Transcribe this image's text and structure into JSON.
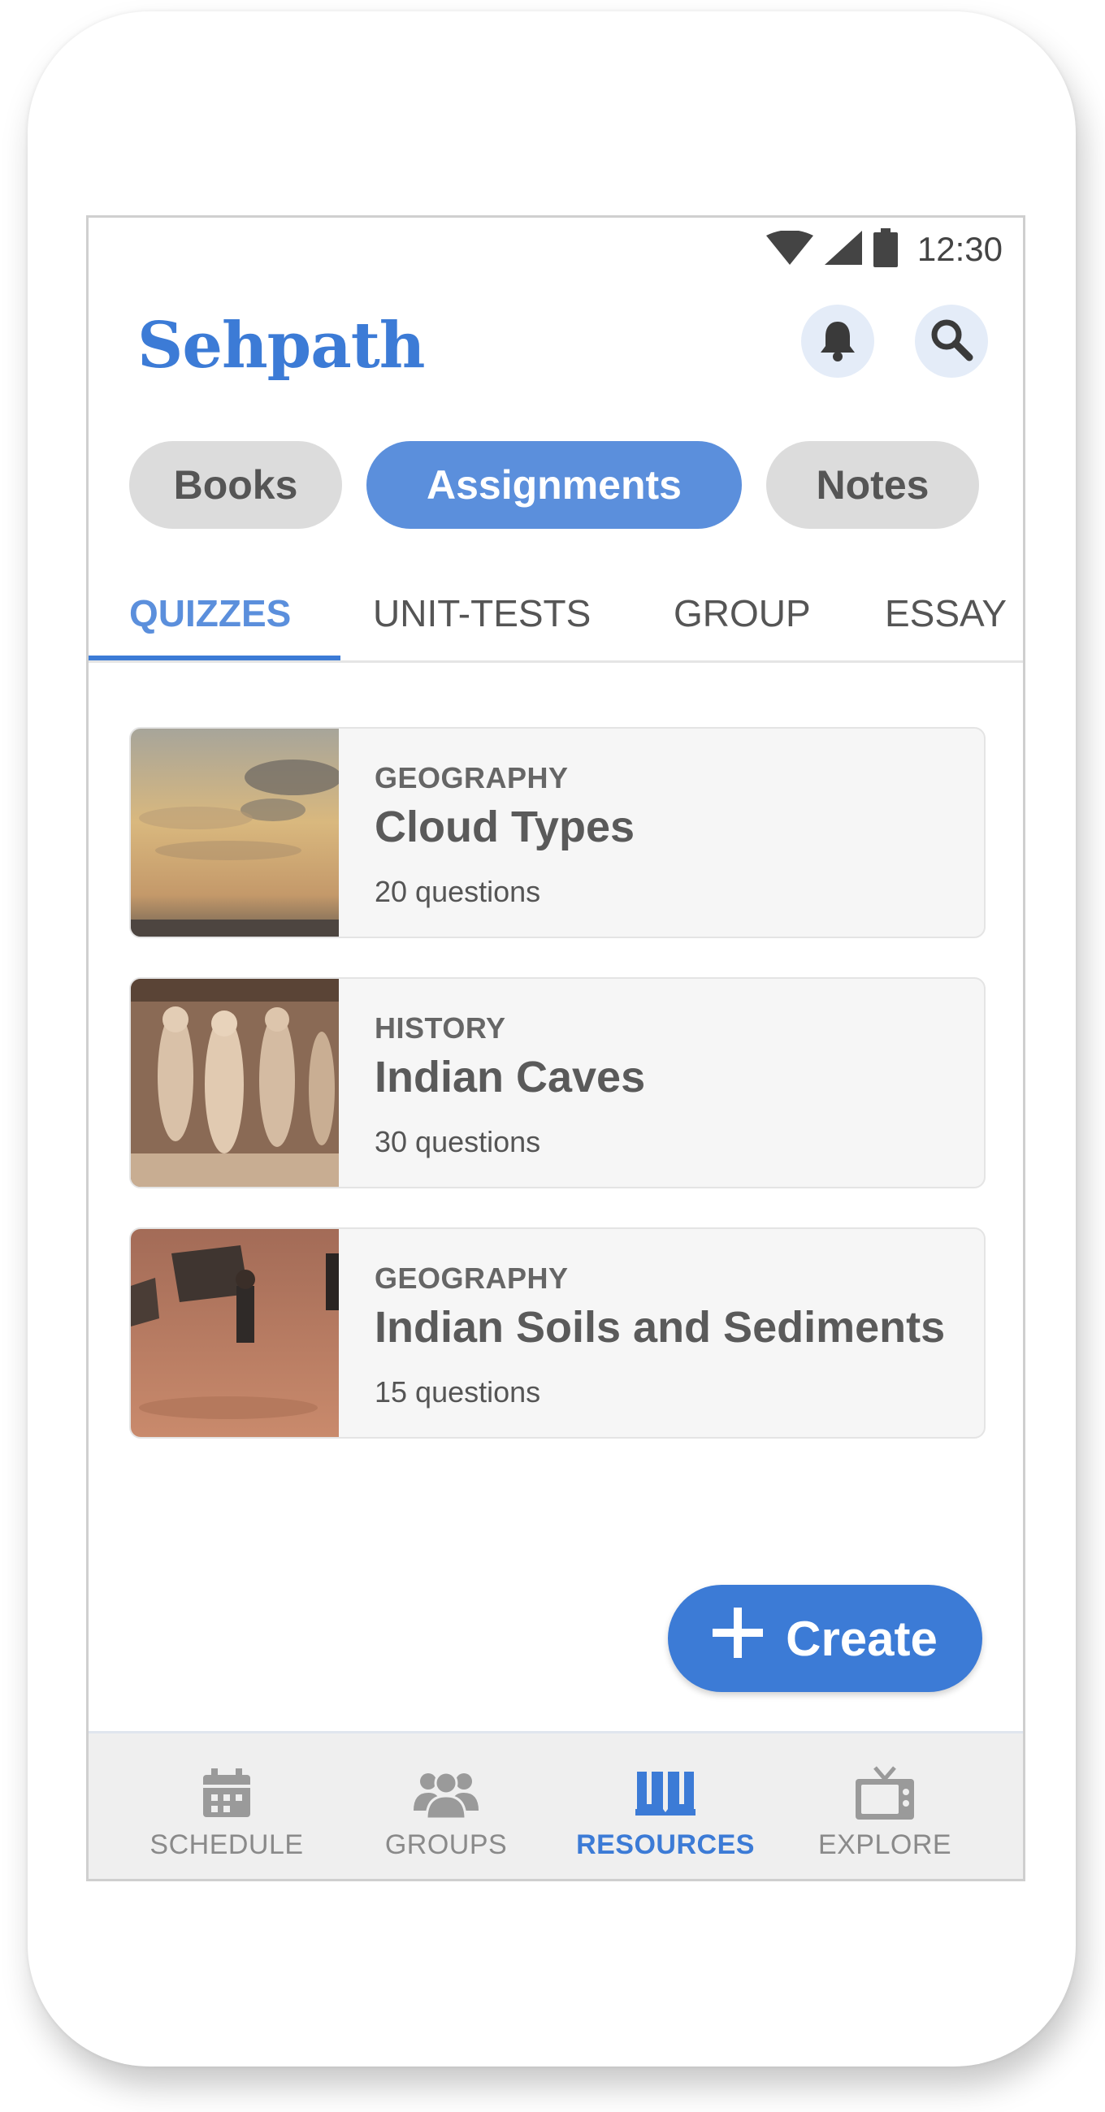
{
  "status_bar": {
    "time": "12:30",
    "icons": [
      "wifi-icon",
      "signal-icon",
      "battery-icon"
    ]
  },
  "header": {
    "logo": "Sehpath",
    "icons": [
      "bell-icon",
      "search-icon"
    ]
  },
  "segments": [
    {
      "label": "Books",
      "active": false
    },
    {
      "label": "Assignments",
      "active": true
    },
    {
      "label": "Notes",
      "active": false
    }
  ],
  "subtabs": [
    {
      "label": "QUIZZES",
      "active": true
    },
    {
      "label": "UNIT-TESTS",
      "active": false
    },
    {
      "label": "GROUP",
      "active": false
    },
    {
      "label": "ESSAY",
      "active": false
    }
  ],
  "cards": [
    {
      "category": "GEOGRAPHY",
      "title": "Cloud Types",
      "meta": "20 questions",
      "image": "sunset-clouds-photo"
    },
    {
      "category": "HISTORY",
      "title": "Indian Caves",
      "meta": "30 questions",
      "image": "temple-carvings-photo"
    },
    {
      "category": "GEOGRAPHY",
      "title": "Indian Soils and Sediments",
      "meta": "15 questions",
      "image": "soil-workers-photo"
    }
  ],
  "fab": {
    "label": "Create",
    "icon": "plus-icon"
  },
  "bottom_nav": [
    {
      "label": "SCHEDULE",
      "icon": "calendar-icon",
      "active": false
    },
    {
      "label": "GROUPS",
      "icon": "people-icon",
      "active": false
    },
    {
      "label": "RESOURCES",
      "icon": "book-icon",
      "active": true
    },
    {
      "label": "EXPLORE",
      "icon": "tv-icon",
      "active": false
    }
  ],
  "colors": {
    "accent": "#3c7bd6",
    "pill_active": "#5b8fdc",
    "pill_inactive": "#dcdcdc",
    "card_bg": "#f6f6f6"
  }
}
